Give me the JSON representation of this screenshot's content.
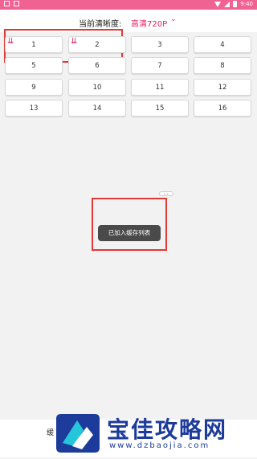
{
  "status_bar": {
    "left_icons": [
      "notification-icon",
      "app-icon"
    ],
    "time": "9:40",
    "right_icons": [
      "wifi-icon",
      "signal-icon",
      "battery-icon"
    ]
  },
  "header": {
    "label": "当前清晰度:",
    "quality": "高清720P",
    "dropdown_icon": "chevron-down-icon"
  },
  "episodes": [
    {
      "label": "1",
      "downloaded": true
    },
    {
      "label": "2",
      "downloaded": true
    },
    {
      "label": "3",
      "downloaded": false
    },
    {
      "label": "4",
      "downloaded": false
    },
    {
      "label": "5",
      "downloaded": false
    },
    {
      "label": "6",
      "downloaded": false
    },
    {
      "label": "7",
      "downloaded": false
    },
    {
      "label": "8",
      "downloaded": false
    },
    {
      "label": "9",
      "downloaded": false
    },
    {
      "label": "10",
      "downloaded": false
    },
    {
      "label": "11",
      "downloaded": false
    },
    {
      "label": "12",
      "downloaded": false
    },
    {
      "label": "13",
      "downloaded": false
    },
    {
      "label": "14",
      "downloaded": false
    },
    {
      "label": "15",
      "downloaded": false
    },
    {
      "label": "16",
      "downloaded": false
    }
  ],
  "toast": {
    "message": "已加入缓存列表"
  },
  "bottom_bar": {
    "cache_label": "缓"
  },
  "watermark": {
    "text": "宝佳攻略网",
    "url": "www.dzbaojia.com"
  },
  "colors": {
    "accent": "#e91e63",
    "status_bar": "#f06292",
    "highlight_box": "#e53935",
    "toast_bg": "#4a4a4a",
    "watermark": "#1d3b9a"
  }
}
